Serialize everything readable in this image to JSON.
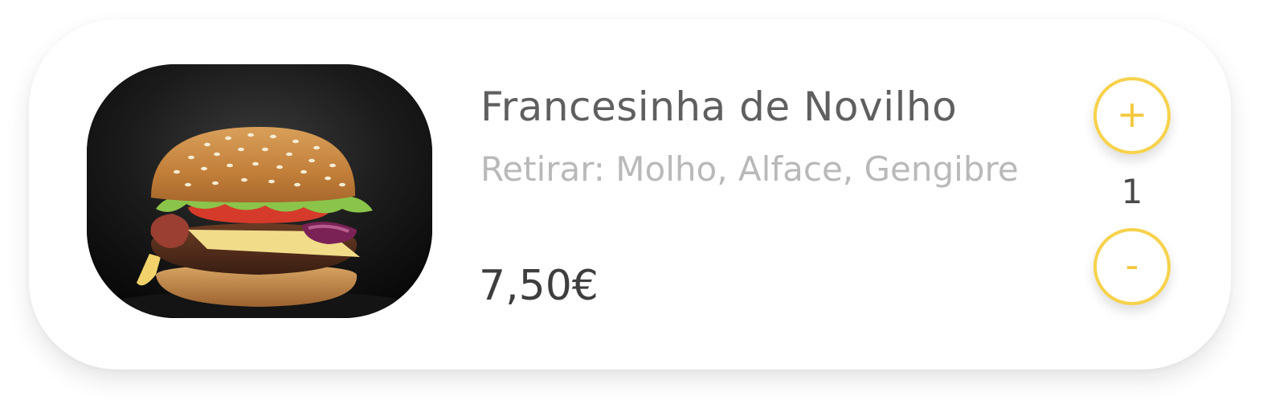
{
  "item": {
    "name": "Francesinha de Novilho",
    "notes": "Retirar: Molho, Alface, Gengibre",
    "price": "7,50€",
    "image_icon": "burger-photo"
  },
  "quantity": {
    "value": "1",
    "increment_label": "+",
    "decrement_label": "-"
  },
  "colors": {
    "accent": "#f7d24b",
    "title": "#5f5f5f",
    "notes": "#b9b9b9",
    "price": "#3e3e3e"
  }
}
